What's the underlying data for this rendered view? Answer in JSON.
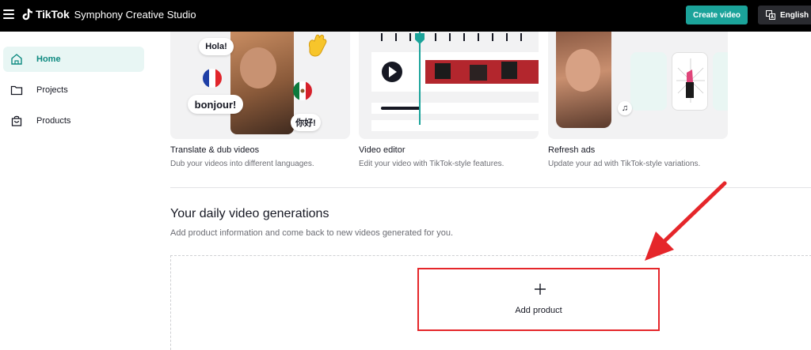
{
  "header": {
    "brand_name": "TikTok",
    "brand_sub": "Symphony Creative Studio",
    "create_label": "Create video",
    "language_label": "English"
  },
  "sidebar": {
    "items": [
      {
        "label": "Home",
        "icon": "home-icon",
        "active": true
      },
      {
        "label": "Projects",
        "icon": "folder-icon",
        "active": false
      },
      {
        "label": "Products",
        "icon": "shopping-bag-icon",
        "active": false
      }
    ]
  },
  "cards": [
    {
      "title": "Translate & dub videos",
      "desc": "Dub your videos into different languages.",
      "bubbles": [
        "Hola!",
        "bonjour!",
        "你好!"
      ]
    },
    {
      "title": "Video editor",
      "desc": "Edit your video with TikTok-style features."
    },
    {
      "title": "Refresh ads",
      "desc": "Update your ad with TikTok-style variations."
    }
  ],
  "daily": {
    "title": "Your daily video generations",
    "desc": "Add product information and come back to new videos generated for you.",
    "add_label": "Add product"
  },
  "colors": {
    "accent": "#1ba39a",
    "highlight": "#e5262a",
    "topbar": "#000000"
  }
}
